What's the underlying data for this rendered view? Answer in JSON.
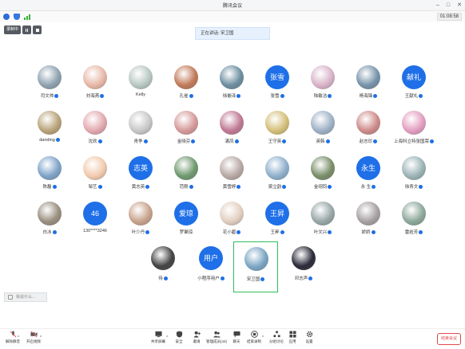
{
  "window": {
    "title": "腾讯会议"
  },
  "timer": "01:08:58",
  "recording": {
    "label": "录制中"
  },
  "speaking": "正在讲话: 宋卫国",
  "participants_rows": [
    [
      {
        "name": "司文帅",
        "avatar": "photo",
        "color": "#8fa2b0",
        "mic": true
      },
      {
        "name": "刘海燕",
        "avatar": "photo",
        "color": "#e8b8a8",
        "mic": true
      },
      {
        "name": "Kelly",
        "avatar": "photo",
        "color": "#b9c8c2",
        "mic": false
      },
      {
        "name": "孔雀",
        "avatar": "photo",
        "color": "#c27a5a",
        "mic": true
      },
      {
        "name": "徐嵌泽",
        "avatar": "photo",
        "color": "#6d8fa1",
        "mic": true
      },
      {
        "name": "张雪",
        "avatar": "text",
        "text": "张雪",
        "mic": true
      },
      {
        "name": "陆敏洁",
        "avatar": "photo",
        "color": "#d9b4c9",
        "mic": true
      },
      {
        "name": "杨海锋",
        "avatar": "photo",
        "color": "#7793aa",
        "mic": true
      },
      {
        "name": "王献礼",
        "avatar": "text",
        "text": "献礼",
        "mic": true
      }
    ],
    [
      {
        "name": "danding",
        "avatar": "photo",
        "color": "#b9a47a",
        "mic": true
      },
      {
        "name": "沈欢",
        "avatar": "photo",
        "color": "#e3a9b0",
        "mic": true
      },
      {
        "name": "青争",
        "avatar": "photo",
        "color": "#c8c8c8",
        "mic": true
      },
      {
        "name": "金晓芬",
        "avatar": "photo",
        "color": "#d69a9a",
        "mic": true
      },
      {
        "name": "滿凤",
        "avatar": "photo",
        "color": "#c07a95",
        "mic": true
      },
      {
        "name": "王守英",
        "avatar": "photo",
        "color": "#d5c07a",
        "mic": true
      },
      {
        "name": "英韩",
        "avatar": "photo",
        "color": "#9fb2c7",
        "mic": true
      },
      {
        "name": "赵志珍",
        "avatar": "photo",
        "color": "#cf8b8b",
        "mic": true
      },
      {
        "name": "上海科立特张国荣",
        "avatar": "photo",
        "color": "#e39fc1",
        "mic": true
      }
    ],
    [
      {
        "name": "陈磊",
        "avatar": "photo",
        "color": "#7fa3c9",
        "mic": true
      },
      {
        "name": "邹艺",
        "avatar": "photo",
        "color": "#f2cbb0",
        "mic": true
      },
      {
        "name": "黄志英",
        "avatar": "text",
        "text": "志英",
        "mic": true
      },
      {
        "name": "范刚",
        "avatar": "photo",
        "color": "#6f9a6f",
        "mic": true
      },
      {
        "name": "黄雪婷",
        "avatar": "photo",
        "color": "#b8a9a6",
        "mic": true
      },
      {
        "name": "梁立韵",
        "avatar": "photo",
        "color": "#8fb0cc",
        "mic": true
      },
      {
        "name": "金翊钧",
        "avatar": "photo",
        "color": "#7a8f6a",
        "mic": true
      },
      {
        "name": "永 生",
        "avatar": "text",
        "text": "永生",
        "mic": true
      },
      {
        "name": "徐青文",
        "avatar": "photo",
        "color": "#9cb4b6",
        "mic": true
      }
    ],
    [
      {
        "name": "白冰",
        "avatar": "photo",
        "color": "#9a8f80",
        "mic": true
      },
      {
        "name": "130****3246",
        "avatar": "text",
        "text": "46",
        "mic": false
      },
      {
        "name": "叶少丹",
        "avatar": "photo",
        "color": "#c9a38d",
        "mic": true
      },
      {
        "name": "罗聚琼",
        "avatar": "text",
        "text": "爱琼",
        "mic": false
      },
      {
        "name": "花小碧",
        "avatar": "photo",
        "color": "#e2d0c2",
        "mic": true
      },
      {
        "name": "王昇",
        "avatar": "text",
        "text": "王昇",
        "mic": true
      },
      {
        "name": "叶文兴",
        "avatar": "photo",
        "color": "#98a7a8",
        "mic": true
      },
      {
        "name": "娇娇",
        "avatar": "photo",
        "color": "#a7a1a4",
        "mic": true
      },
      {
        "name": "雷岩芳",
        "avatar": "photo",
        "color": "#8ea99c",
        "mic": true
      }
    ],
    [
      {
        "name": "待",
        "avatar": "photo",
        "color": "#444444",
        "mic": true
      },
      {
        "name": "小程序用户",
        "avatar": "text",
        "text": "用户",
        "mic": true
      },
      {
        "name": "宋卫国",
        "avatar": "photo",
        "color": "#7ba6c4",
        "mic": true,
        "active": true
      },
      {
        "name": "邓志声",
        "avatar": "photo",
        "color": "#2b2b3a",
        "mic": true
      }
    ]
  ],
  "chat_preview": "我说什么...",
  "toolbar": {
    "unmute": "解除静音",
    "video": "开启视频",
    "share": "共享屏幕",
    "security": "安全",
    "invite": "邀请",
    "members": "管理成员(43)",
    "chat": "聊天",
    "record": "结束录制",
    "breakout": "分组讨论",
    "apps": "应用",
    "settings": "设置",
    "end": "结束会议"
  }
}
